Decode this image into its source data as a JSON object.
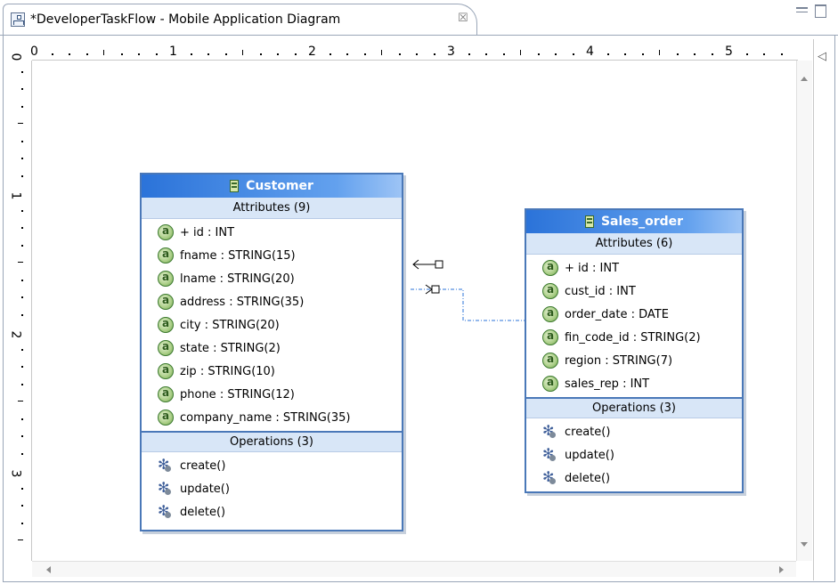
{
  "tab": {
    "title": "*DeveloperTaskFlow - Mobile Application Diagram",
    "close_glyph": "☒"
  },
  "ruler": {
    "h_labels": [
      "0",
      "1",
      "2",
      "3",
      "4",
      "5"
    ],
    "v_labels": [
      "0",
      "1",
      "2",
      "3"
    ]
  },
  "diagram": {
    "customer": {
      "name": "Customer",
      "attributes_title": "Attributes (9)",
      "attributes": [
        "+ id : INT",
        "fname : STRING(15)",
        "lname : STRING(20)",
        "address : STRING(35)",
        "city : STRING(20)",
        "state : STRING(2)",
        "zip : STRING(10)",
        "phone : STRING(12)",
        "company_name : STRING(35)"
      ],
      "operations_title": "Operations (3)",
      "operations": [
        "create()",
        "update()",
        "delete()"
      ]
    },
    "sales_order": {
      "name": "Sales_order",
      "attributes_title": "Attributes (6)",
      "attributes": [
        "+ id : INT",
        "cust_id : INT",
        "order_date : DATE",
        "fin_code_id : STRING(2)",
        "region : STRING(7)",
        "sales_rep : INT"
      ],
      "operations_title": "Operations (3)",
      "operations": [
        "create()",
        "update()",
        "delete()"
      ]
    }
  },
  "colors": {
    "header_gradient_start": "#2b73d9",
    "box_border": "#4a78b8",
    "section_bg": "#d8e6f7",
    "connector": "#2b73d9"
  },
  "icons": {
    "tab": "diagram-icon",
    "class": "class-icon",
    "attribute": "attribute-icon",
    "operation": "operation-icon"
  }
}
